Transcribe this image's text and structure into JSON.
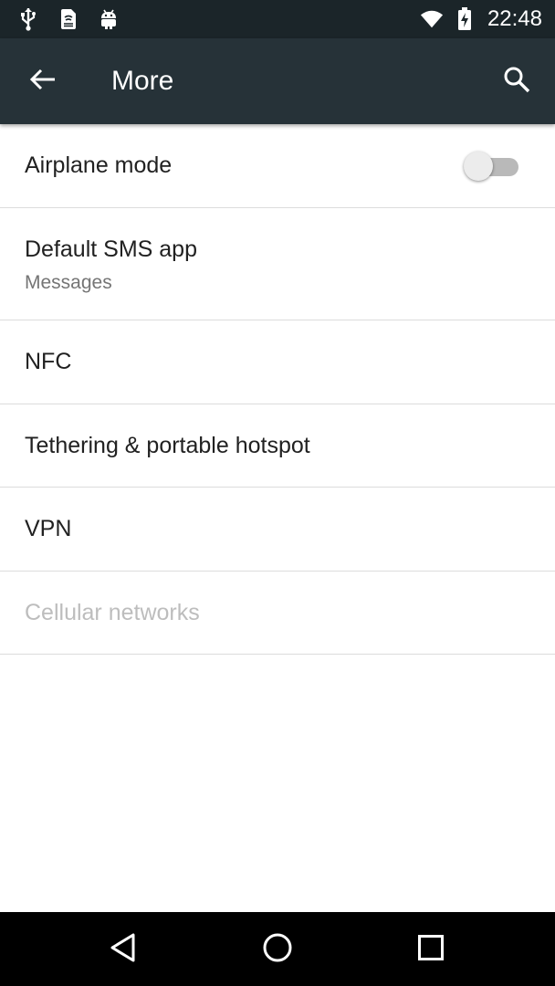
{
  "status_bar": {
    "time": "22:48",
    "icons_left": [
      "usb-icon",
      "sim-card-icon",
      "android-icon"
    ],
    "icons_right": [
      "wifi-icon",
      "battery-icon"
    ],
    "color": "#1b2529"
  },
  "app_bar": {
    "title": "More",
    "back_icon": "arrow-back-icon",
    "search_icon": "search-icon",
    "color": "#263238"
  },
  "settings": {
    "airplane_mode": {
      "label": "Airplane mode",
      "enabled": false
    },
    "default_sms": {
      "label": "Default SMS app",
      "value": "Messages"
    },
    "nfc": {
      "label": "NFC"
    },
    "tethering": {
      "label": "Tethering & portable hotspot"
    },
    "vpn": {
      "label": "VPN"
    },
    "cellular": {
      "label": "Cellular networks",
      "disabled": true
    }
  },
  "nav_bar": {
    "buttons": [
      "back-triangle-icon",
      "home-circle-icon",
      "recents-square-icon"
    ]
  }
}
